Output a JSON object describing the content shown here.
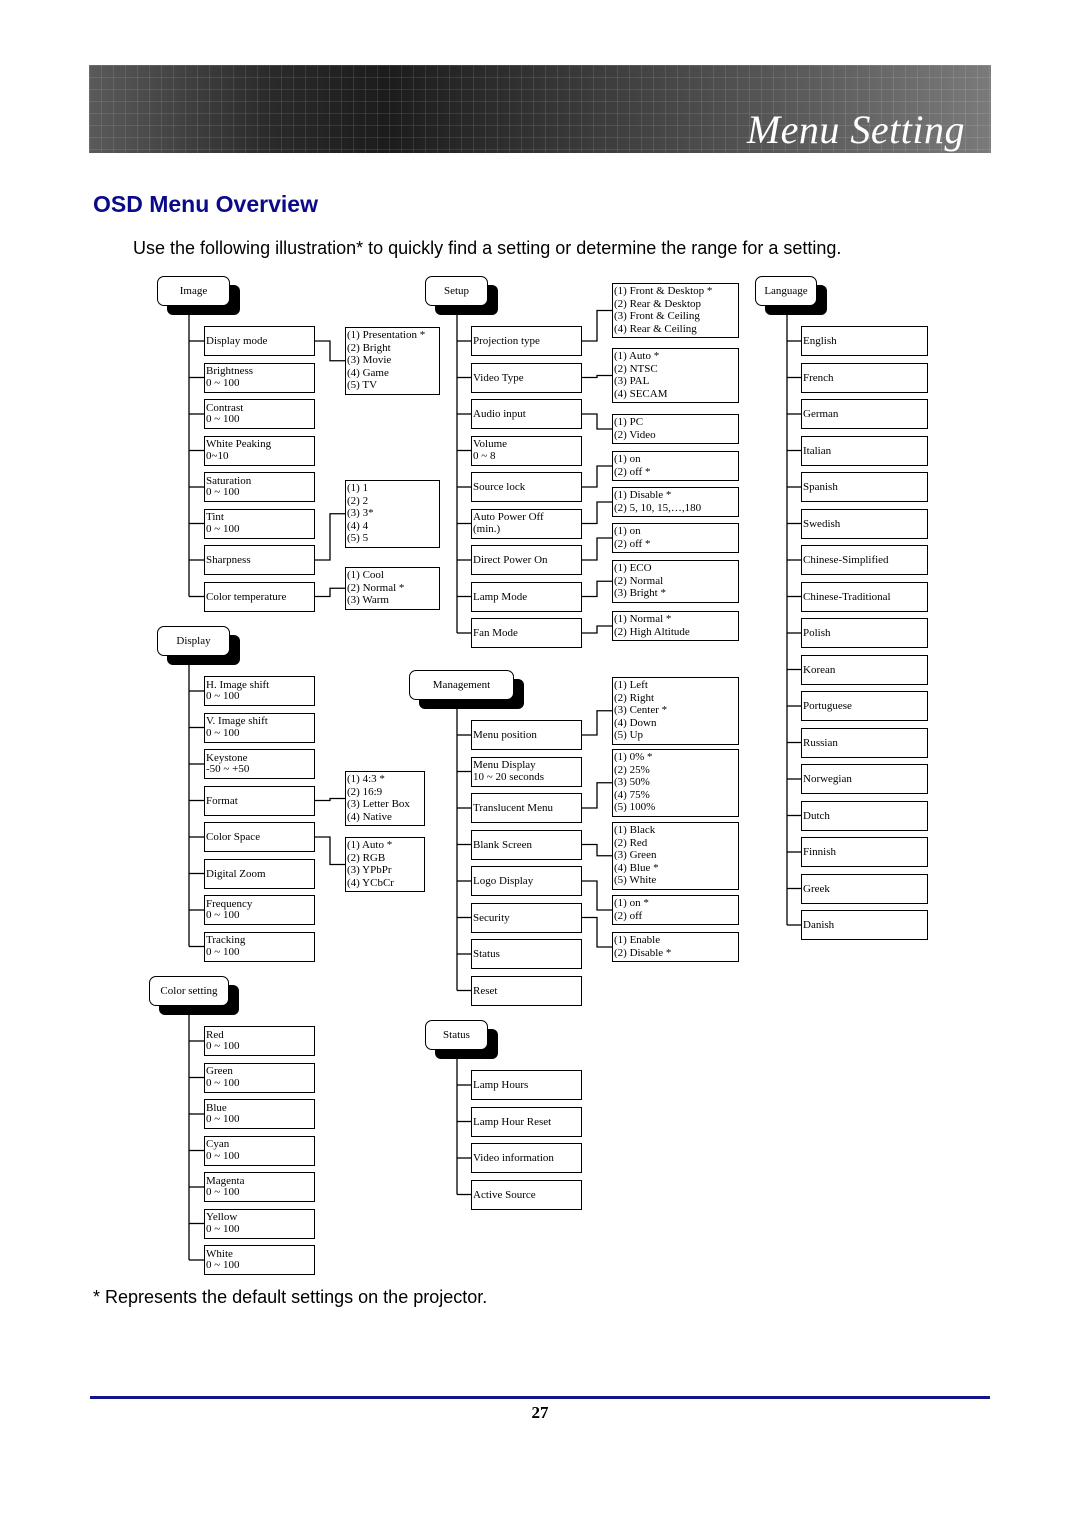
{
  "header": {
    "title": "Menu Setting"
  },
  "section_title": "OSD Menu Overview",
  "intro": "Use the following illustration* to quickly find a setting or determine the range for a setting.",
  "footnote": "* Represents the default settings on the projector.",
  "page_number": "27",
  "colors": {
    "heading": "#0a0a8a",
    "rule": "#14148a"
  },
  "menus": [
    {
      "title": "Image",
      "items": [
        {
          "lines": [
            "Display mode"
          ],
          "options": [
            "(1) Presentation *",
            "(2) Bright",
            "(3) Movie",
            "(4) Game",
            "(5) TV"
          ]
        },
        {
          "lines": [
            "Brightness",
            "0 ~ 100"
          ]
        },
        {
          "lines": [
            "Contrast",
            "0 ~ 100"
          ]
        },
        {
          "lines": [
            "White Peaking",
            "0~10"
          ]
        },
        {
          "lines": [
            "Saturation",
            "0 ~ 100"
          ]
        },
        {
          "lines": [
            "Tint",
            "0 ~ 100"
          ]
        },
        {
          "lines": [
            "Sharpness"
          ],
          "options": [
            "(1) 1",
            "(2) 2",
            "(3) 3*",
            "(4) 4",
            "(5) 5"
          ]
        },
        {
          "lines": [
            "Color temperature"
          ],
          "options": [
            "(1) Cool",
            "(2) Normal *",
            "(3) Warm"
          ]
        }
      ]
    },
    {
      "title": "Display",
      "items": [
        {
          "lines": [
            "H. Image shift",
            "0 ~ 100"
          ]
        },
        {
          "lines": [
            "V. Image shift",
            "0 ~ 100"
          ]
        },
        {
          "lines": [
            "Keystone",
            "-50 ~ +50"
          ]
        },
        {
          "lines": [
            "Format"
          ],
          "options": [
            "(1) 4:3 *",
            "(2) 16:9",
            "(3) Letter Box",
            "(4) Native"
          ]
        },
        {
          "lines": [
            "Color Space"
          ],
          "options": [
            "(1) Auto *",
            "(2) RGB",
            "(3) YPbPr",
            "(4) YCbCr"
          ]
        },
        {
          "lines": [
            "Digital Zoom"
          ]
        },
        {
          "lines": [
            "Frequency",
            "0 ~ 100"
          ]
        },
        {
          "lines": [
            "Tracking",
            "0 ~ 100"
          ]
        }
      ]
    },
    {
      "title": "Color setting",
      "items": [
        {
          "lines": [
            "Red",
            "0 ~ 100"
          ]
        },
        {
          "lines": [
            "Green",
            "0 ~ 100"
          ]
        },
        {
          "lines": [
            "Blue",
            "0 ~ 100"
          ]
        },
        {
          "lines": [
            "Cyan",
            "0 ~ 100"
          ]
        },
        {
          "lines": [
            "Magenta",
            "0 ~ 100"
          ]
        },
        {
          "lines": [
            "Yellow",
            "0 ~ 100"
          ]
        },
        {
          "lines": [
            "White",
            "0 ~ 100"
          ]
        }
      ]
    },
    {
      "title": "Setup",
      "items": [
        {
          "lines": [
            "Projection type"
          ],
          "options": [
            "(1) Front & Desktop *",
            "(2) Rear & Desktop",
            "(3) Front & Ceiling",
            "(4) Rear & Ceiling"
          ]
        },
        {
          "lines": [
            "Video Type"
          ],
          "options": [
            "(1) Auto *",
            "(2) NTSC",
            "(3) PAL",
            "(4) SECAM"
          ]
        },
        {
          "lines": [
            "Audio input"
          ],
          "options": [
            "(1) PC",
            "(2) Video"
          ]
        },
        {
          "lines": [
            "Volume",
            "0 ~ 8"
          ]
        },
        {
          "lines": [
            "Source lock"
          ],
          "options": [
            "(1) on",
            "(2) off *"
          ]
        },
        {
          "lines": [
            "Auto Power Off",
            "(min.)"
          ],
          "options": [
            "(1) Disable *",
            "(2) 5, 10, 15,…,180"
          ]
        },
        {
          "lines": [
            "Direct Power On"
          ],
          "options": [
            "(1) on",
            "(2) off *"
          ]
        },
        {
          "lines": [
            "Lamp Mode"
          ],
          "options": [
            "(1) ECO",
            "(2) Normal",
            "(3) Bright *"
          ]
        },
        {
          "lines": [
            "Fan Mode"
          ],
          "options": [
            "(1) Normal *",
            "(2) High Altitude"
          ]
        }
      ]
    },
    {
      "title": "Management",
      "items": [
        {
          "lines": [
            "Menu position"
          ],
          "options": [
            "(1) Left",
            "(2) Right",
            "(3) Center *",
            "(4) Down",
            "(5) Up"
          ]
        },
        {
          "lines": [
            "Menu Display",
            "10 ~ 20 seconds"
          ]
        },
        {
          "lines": [
            "Translucent Menu"
          ],
          "options": [
            "(1) 0% *",
            "(2) 25%",
            "(3) 50%",
            "(4) 75%",
            "(5) 100%"
          ]
        },
        {
          "lines": [
            "Blank Screen"
          ],
          "options": [
            "(1) Black",
            "(2) Red",
            "(3) Green",
            "(4) Blue *",
            "(5) White"
          ]
        },
        {
          "lines": [
            "Logo Display"
          ],
          "options": [
            "(1) on *",
            "(2) off"
          ]
        },
        {
          "lines": [
            "Security"
          ],
          "options": [
            "(1) Enable",
            "(2) Disable *"
          ]
        },
        {
          "lines": [
            "Status"
          ]
        },
        {
          "lines": [
            "Reset"
          ]
        }
      ]
    },
    {
      "title": "Status",
      "items": [
        {
          "lines": [
            "Lamp Hours"
          ]
        },
        {
          "lines": [
            "Lamp Hour Reset"
          ]
        },
        {
          "lines": [
            "Video information"
          ]
        },
        {
          "lines": [
            "Active Source"
          ]
        }
      ]
    },
    {
      "title": "Language",
      "items": [
        {
          "lines": [
            "English"
          ]
        },
        {
          "lines": [
            "French"
          ]
        },
        {
          "lines": [
            "German"
          ]
        },
        {
          "lines": [
            "Italian"
          ]
        },
        {
          "lines": [
            "Spanish"
          ]
        },
        {
          "lines": [
            "Swedish"
          ]
        },
        {
          "lines": [
            "Chinese-Simplified"
          ]
        },
        {
          "lines": [
            "Chinese-Traditional"
          ]
        },
        {
          "lines": [
            "Polish"
          ]
        },
        {
          "lines": [
            "Korean"
          ]
        },
        {
          "lines": [
            "Portuguese"
          ]
        },
        {
          "lines": [
            "Russian"
          ]
        },
        {
          "lines": [
            "Norwegian"
          ]
        },
        {
          "lines": [
            "Dutch"
          ]
        },
        {
          "lines": [
            "Finnish"
          ]
        },
        {
          "lines": [
            "Greek"
          ]
        },
        {
          "lines": [
            "Danish"
          ]
        }
      ]
    }
  ]
}
